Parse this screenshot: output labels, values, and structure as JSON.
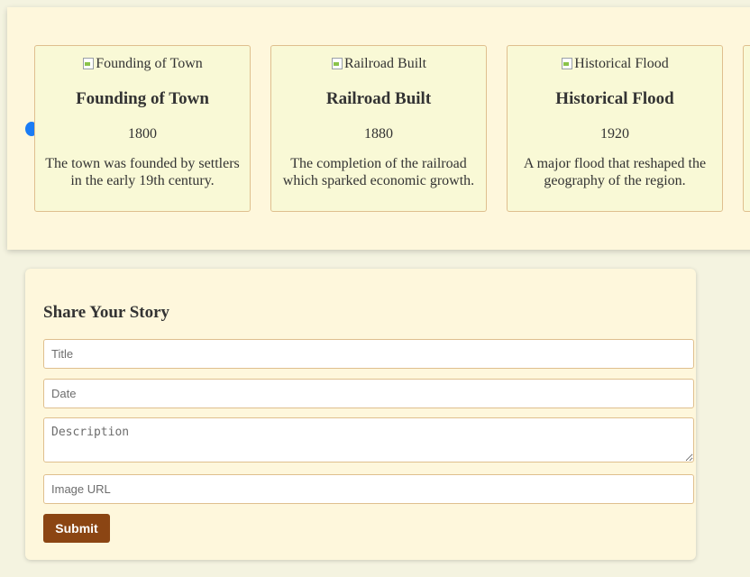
{
  "timeline": {
    "events": [
      {
        "image_alt": "Founding of Town",
        "title": "Founding of Town",
        "year": "1800",
        "description": "The town was founded by settlers in the early 19th century."
      },
      {
        "image_alt": "Railroad Built",
        "title": "Railroad Built",
        "year": "1880",
        "description": "The completion of the railroad which sparked economic growth."
      },
      {
        "image_alt": "Historical Flood",
        "title": "Historical Flood",
        "year": "1920",
        "description": "A major flood that reshaped the geography of the region."
      }
    ]
  },
  "story_form": {
    "heading": "Share Your Story",
    "title_placeholder": "Title",
    "date_placeholder": "Date",
    "description_placeholder": "Description",
    "image_url_placeholder": "Image URL",
    "submit_label": "Submit"
  },
  "colors": {
    "timeline_marker": "#1a7cf5",
    "submit_button": "#8b4513",
    "card_background": "#f9f9d6",
    "panel_background": "#fef7dc"
  }
}
